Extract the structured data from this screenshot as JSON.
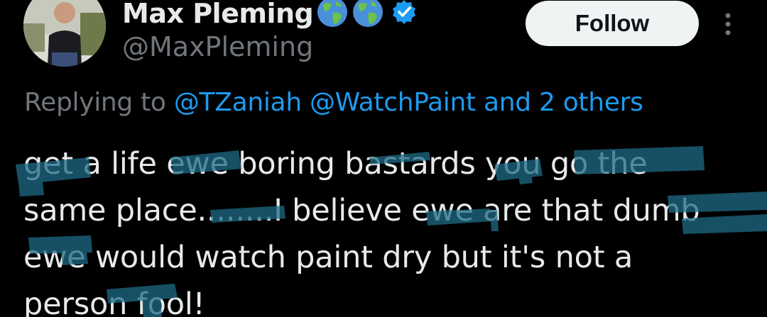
{
  "author": {
    "display_name": "Max Pleming",
    "handle": "@MaxPleming",
    "badges": [
      "globe-emoji",
      "globe-emoji",
      "verified-badge"
    ]
  },
  "follow_label": "Follow",
  "reply": {
    "prefix": "Replying to",
    "mentions": "@TZaniah @WatchPaint and 2 others"
  },
  "tweet": {
    "lines": [
      "get a life ewe boring bastards you go the",
      "same place........I believe ewe are that dumb",
      "ewe would watch paint dry but it's not a",
      "person fool!"
    ]
  },
  "colors": {
    "background": "#000000",
    "text": "#e7e9ea",
    "muted": "#71767b",
    "mention": "#1d9bf0",
    "verified": "#1d9bf0",
    "scribble": "#1f6b86"
  }
}
